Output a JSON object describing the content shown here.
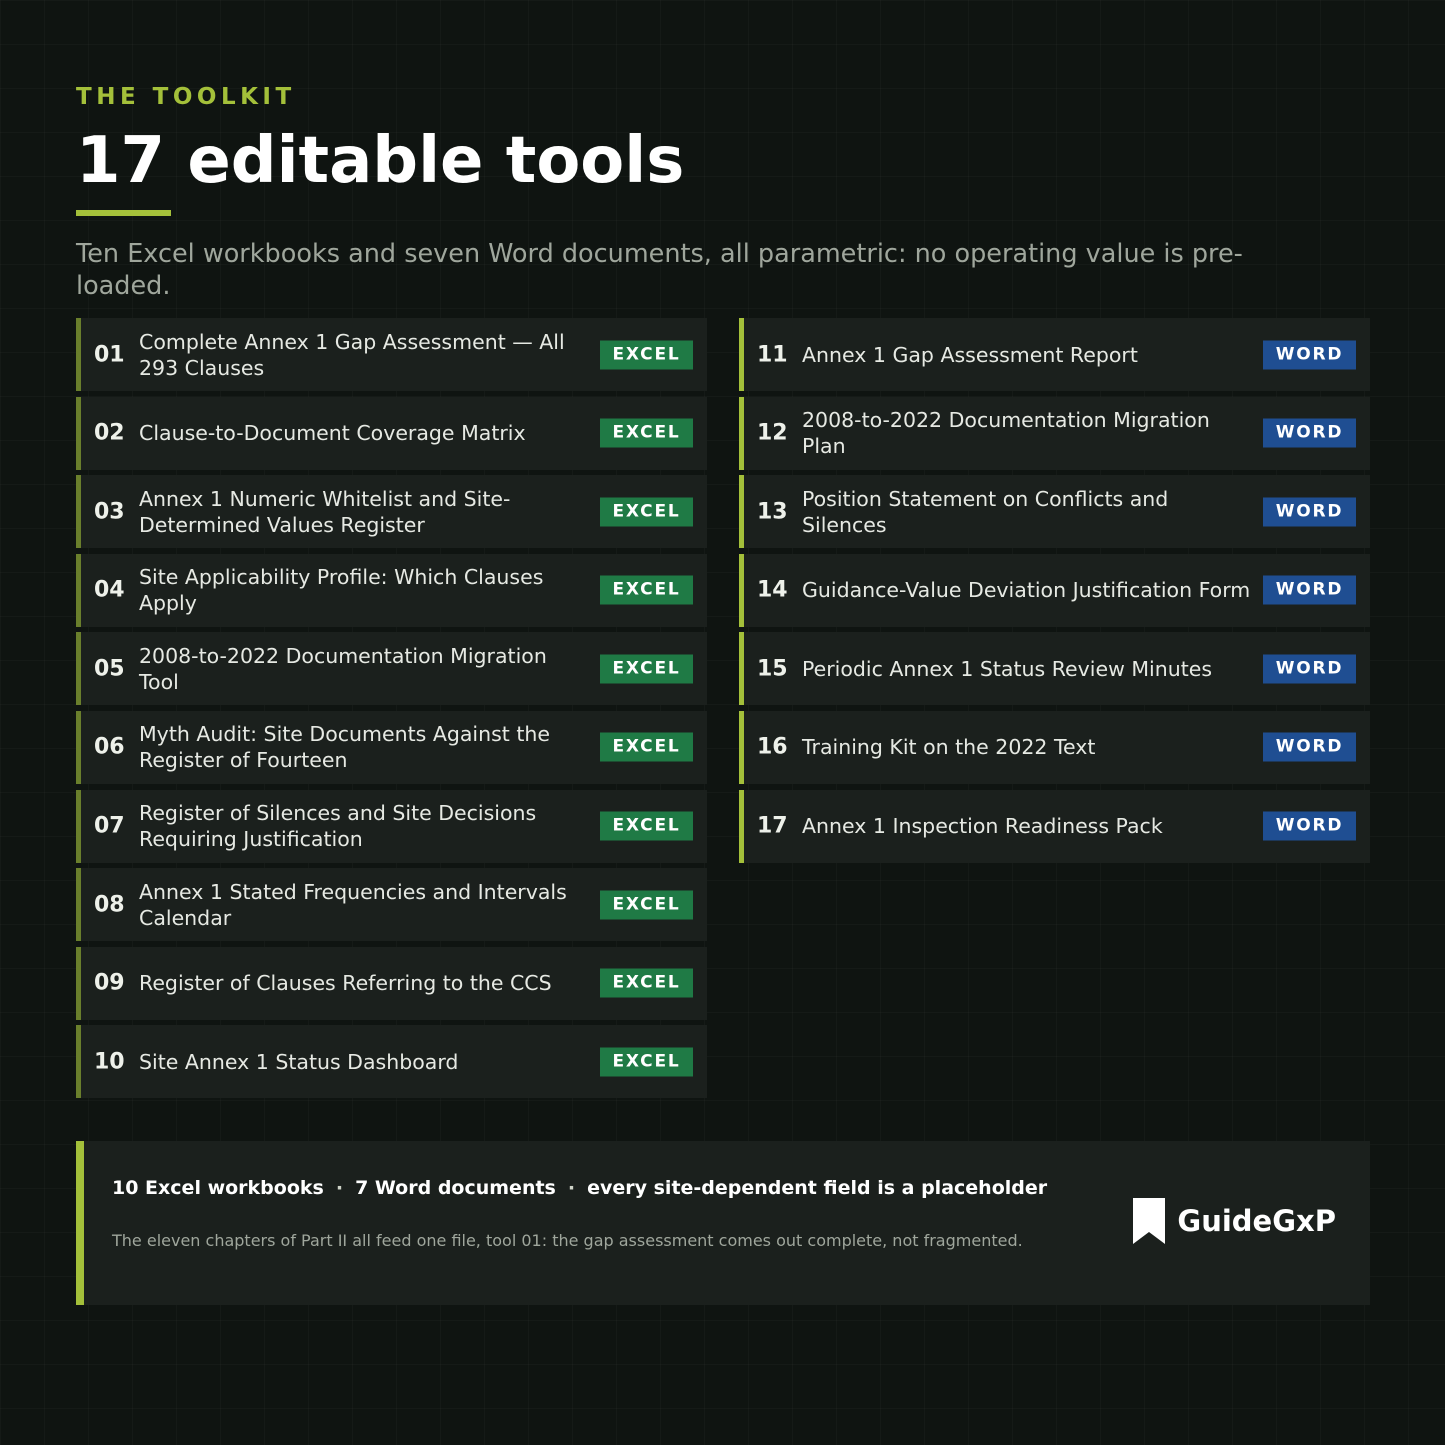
{
  "eyebrow": "THE TOOLKIT",
  "title": "17 editable tools",
  "subtitle": "Ten Excel workbooks and seven Word documents, all parametric: no operating value is pre-loaded.",
  "colors": {
    "accent": "#a4c03a",
    "excel_badge": "#1f7a45",
    "word_badge": "#1f4e92",
    "background": "#0f1411",
    "row": "#1b201d"
  },
  "tools_left": [
    {
      "number": "01",
      "name": "Complete Annex 1 Gap Assessment — All 293 Clauses",
      "format": "EXCEL"
    },
    {
      "number": "02",
      "name": "Clause-to-Document Coverage Matrix",
      "format": "EXCEL"
    },
    {
      "number": "03",
      "name": "Annex 1 Numeric Whitelist and Site-Determined Values Register",
      "format": "EXCEL"
    },
    {
      "number": "04",
      "name": "Site Applicability Profile: Which Clauses Apply",
      "format": "EXCEL"
    },
    {
      "number": "05",
      "name": "2008-to-2022 Documentation Migration Tool",
      "format": "EXCEL"
    },
    {
      "number": "06",
      "name": "Myth Audit: Site Documents Against the Register of Fourteen",
      "format": "EXCEL"
    },
    {
      "number": "07",
      "name": "Register of Silences and Site Decisions Requiring Justification",
      "format": "EXCEL"
    },
    {
      "number": "08",
      "name": "Annex 1 Stated Frequencies and Intervals Calendar",
      "format": "EXCEL"
    },
    {
      "number": "09",
      "name": "Register of Clauses Referring to the CCS",
      "format": "EXCEL"
    },
    {
      "number": "10",
      "name": "Site Annex 1 Status Dashboard",
      "format": "EXCEL"
    }
  ],
  "tools_right": [
    {
      "number": "11",
      "name": "Annex 1 Gap Assessment Report",
      "format": "WORD"
    },
    {
      "number": "12",
      "name": "2008-to-2022 Documentation Migration Plan",
      "format": "WORD"
    },
    {
      "number": "13",
      "name": "Position Statement on Conflicts and Silences",
      "format": "WORD"
    },
    {
      "number": "14",
      "name": "Guidance-Value Deviation Justification Form",
      "format": "WORD"
    },
    {
      "number": "15",
      "name": "Periodic Annex 1 Status Review Minutes",
      "format": "WORD"
    },
    {
      "number": "16",
      "name": "Training Kit on the 2022 Text",
      "format": "WORD"
    },
    {
      "number": "17",
      "name": "Annex 1 Inspection Readiness Pack",
      "format": "WORD"
    }
  ],
  "footer": {
    "stats": [
      "10 Excel workbooks",
      "7 Word documents",
      "every site-dependent field is a placeholder"
    ],
    "separator": "·",
    "note": "The eleven chapters of Part II all feed one file, tool 01: the gap assessment comes out complete, not fragmented.",
    "brand_name": "GuideGxP",
    "brand_icon": "bookmark-icon"
  }
}
